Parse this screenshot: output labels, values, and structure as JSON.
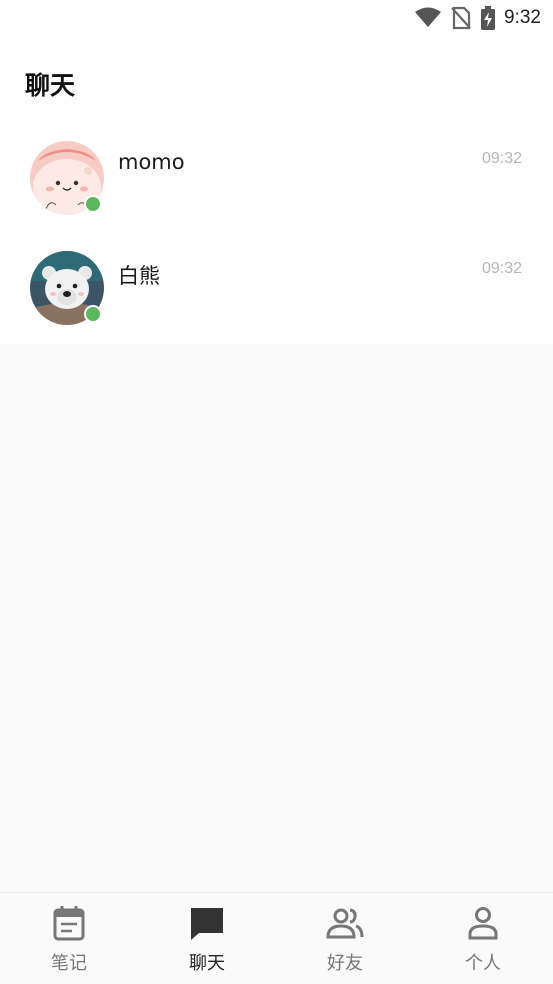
{
  "status_bar": {
    "time": "9:32"
  },
  "header": {
    "title": "聊天"
  },
  "chats": [
    {
      "name": "momo",
      "time": "09:32",
      "online": true
    },
    {
      "name": "白熊",
      "time": "09:32",
      "online": true
    }
  ],
  "tabs": [
    {
      "label": "笔记",
      "icon": "notebook-icon",
      "active": false
    },
    {
      "label": "聊天",
      "icon": "chat-bubble-icon",
      "active": true
    },
    {
      "label": "好友",
      "icon": "friends-icon",
      "active": false
    },
    {
      "label": "个人",
      "icon": "person-icon",
      "active": false
    }
  ],
  "colors": {
    "online": "#5cb85c",
    "background": "#f9f9f9",
    "active_tab": "#222222",
    "inactive_tab": "#777777"
  }
}
